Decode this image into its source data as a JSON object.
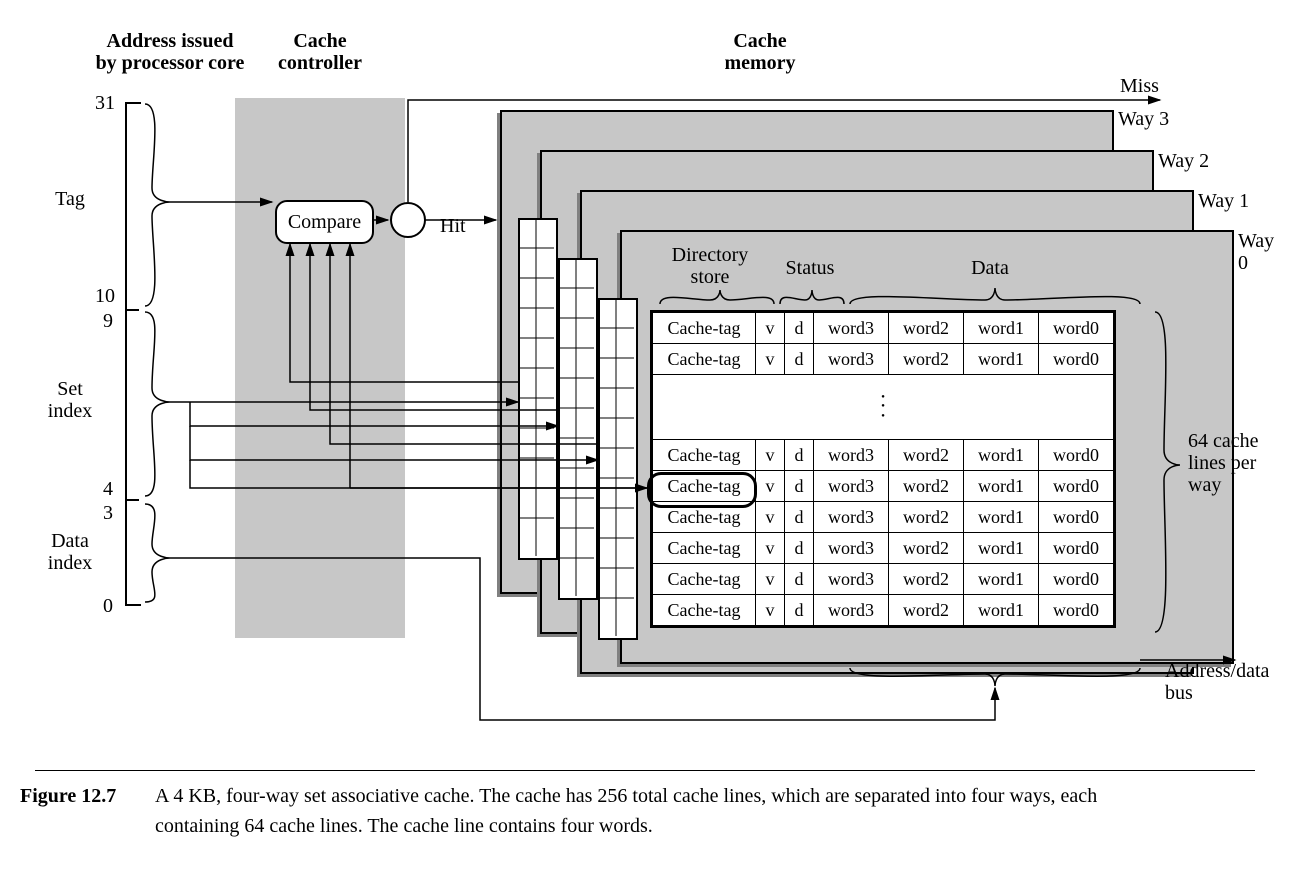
{
  "headers": {
    "address": "Address issued\nby processor core",
    "controller": "Cache\ncontroller",
    "memory": "Cache\nmemory"
  },
  "address_field": {
    "bits": {
      "top": "31",
      "split1a": "10",
      "split1b": "9",
      "split2a": "4",
      "split2b": "3",
      "bottom": "0"
    },
    "labels": {
      "tag": "Tag",
      "set_index": "Set\nindex",
      "data_index": "Data\nindex"
    }
  },
  "controller": {
    "compare": "Compare"
  },
  "signals": {
    "hit": "Hit",
    "miss": "Miss",
    "addr_data_bus": "Address/data\nbus"
  },
  "ways": {
    "w3": "Way 3",
    "w2": "Way 2",
    "w1": "Way 1",
    "w0": "Way 0"
  },
  "way0": {
    "col_groups": {
      "dir": "Directory\nstore",
      "status": "Status",
      "data": "Data"
    },
    "row_cols": {
      "tag": "Cache-tag",
      "v": "v",
      "d": "d",
      "w3": "word3",
      "w2": "word2",
      "w1": "word1",
      "w0": "word0"
    }
  },
  "side_note": "64 cache\nlines per\nway",
  "figure": {
    "num": "Figure 12.7",
    "text": "A 4 KB, four-way set associative cache. The cache has 256 total cache lines, which are separated into four ways, each containing 64 cache lines. The cache line contains four words."
  }
}
